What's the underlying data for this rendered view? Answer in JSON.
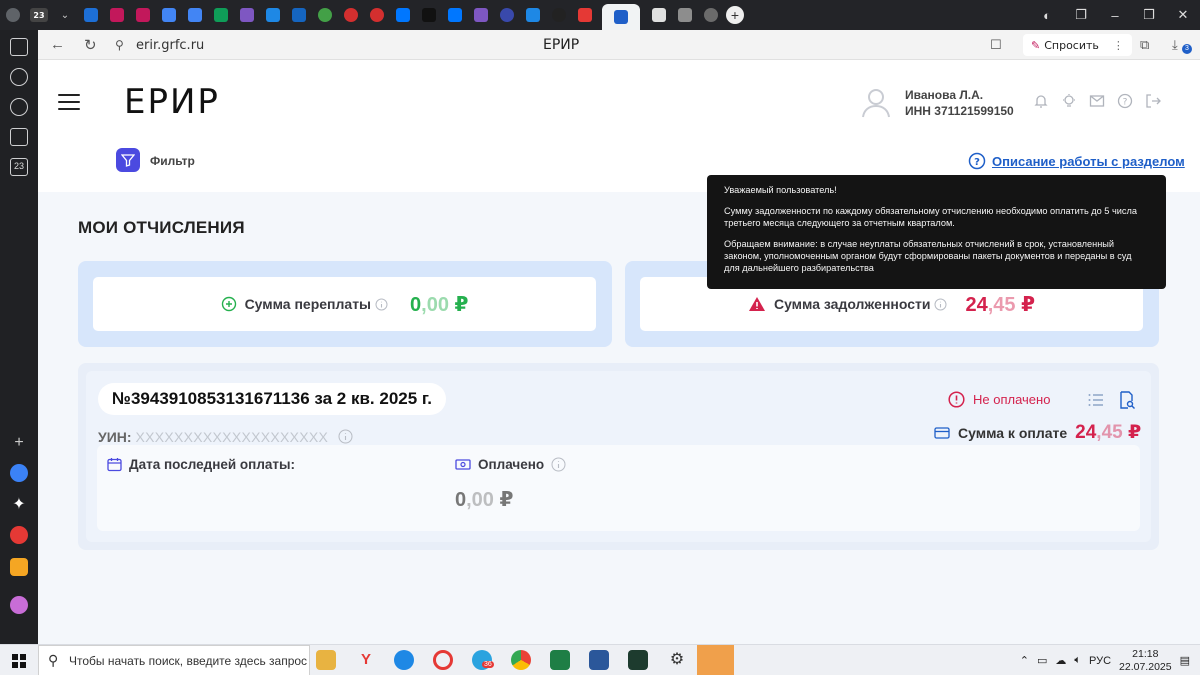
{
  "browser": {
    "url": "erir.grfc.ru",
    "page_title": "ЕРИР",
    "ask_label": "Спросить",
    "tab_count_badge": "23",
    "downloads_badge": "3"
  },
  "header": {
    "logo": "ЕРИР",
    "user_name": "Иванова Л.А.",
    "user_inn": "ИНН 371121599150",
    "filter_label": "Фильтр",
    "help_link": "Описание работы с разделом"
  },
  "section": {
    "title": "МОИ ОТЧИСЛЕНИЯ"
  },
  "summary": {
    "overpay_label": "Сумма переплаты",
    "overpay_int": "0",
    "overpay_frac": ",00",
    "debt_label": "Сумма задолженности",
    "debt_int": "24",
    "debt_frac": ",45",
    "currency": "₽"
  },
  "tooltip": {
    "line1": "Уважаемый пользователь!",
    "line2": "Сумму задолженности по каждому обязательному отчислению необходимо оплатить до 5 числа третьего месяца следующего за отчетным кварталом.",
    "line3": "Обращаем внимание: в случае неуплаты обязательных отчислений в срок, установленный законом, уполномоченным органом будут сформированы пакеты документов и переданы в суд для дальнейшего разбирательства"
  },
  "document": {
    "number": "№3943910853131671136 за 2 кв. 2025 г.",
    "uin_label": "УИН:",
    "uin_value": "XXXXXXXXXXXXXXXXXXXX",
    "status": "Не оплачено",
    "pay_label": "Сумма к оплате",
    "pay_int": "24",
    "pay_frac": ",45",
    "last_pay_label": "Дата последней оплаты:",
    "paid_label": "Оплачено",
    "paid_int": "0",
    "paid_frac": ",00",
    "currency": "₽"
  },
  "taskbar": {
    "search_placeholder": "Чтобы начать поиск, введите здесь запрос",
    "lang": "РУС",
    "time": "21:18",
    "date": "22.07.2025",
    "telegram_badge": "36"
  },
  "colors": {
    "accent_blue": "#1f5fc8",
    "debt_red": "#d4224d",
    "overpay_green": "#25b04e",
    "filter_purple": "#4b4ae0"
  }
}
